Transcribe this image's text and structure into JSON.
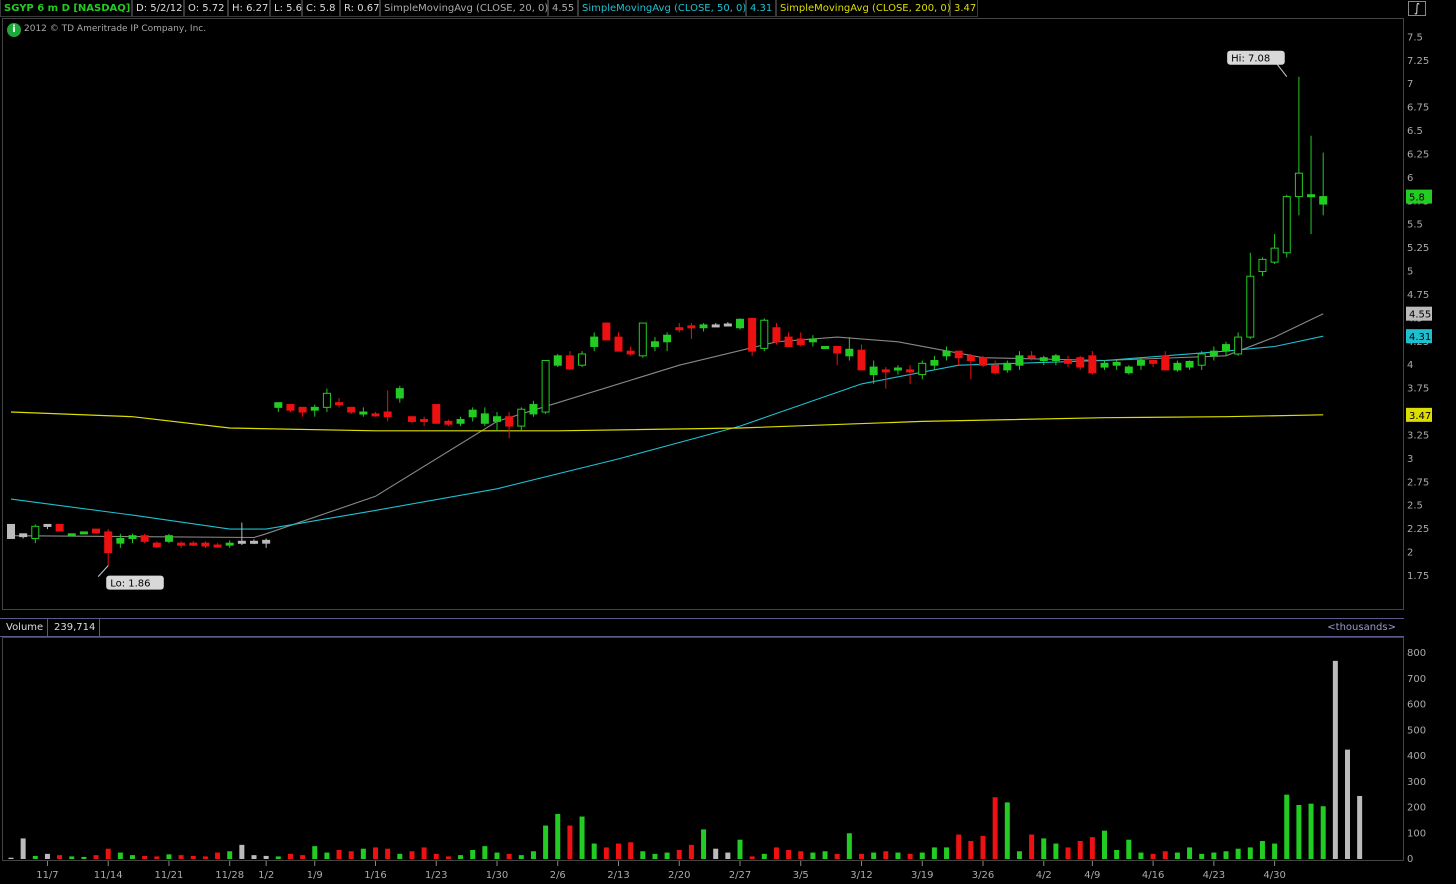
{
  "header": {
    "symbol": "SGYP 6 m D [NASDAQ]",
    "date": "D: 5/2/12",
    "open": "O: 5.72",
    "high": "H: 6.27",
    "low": "L: 5.6",
    "close": "C: 5.8",
    "range": "R: 0.67",
    "sma20_label": "SimpleMovingAvg (CLOSE, 20, 0)",
    "sma20_value": "4.55",
    "sma50_label": "SimpleMovingAvg (CLOSE, 50, 0)",
    "sma50_value": "4.31",
    "sma200_label": "SimpleMovingAvg (CLOSE, 200, 0)",
    "sma200_value": "3.47"
  },
  "copyright": "2012 © TD Ameritrade IP Company, Inc.",
  "icons": {
    "info": "info-icon",
    "tool": "drawing-tool-icon"
  },
  "colors": {
    "up": "#22cc22",
    "down": "#ee1111",
    "neutral": "#bbbbbb",
    "sma20": "#888888",
    "sma50": "#1ec0d0",
    "sma200": "#dddd00",
    "header_symbol": "#22cc22"
  },
  "volume_panel": {
    "label": "Volume",
    "value": "239,714",
    "units": "<thousands>"
  },
  "chart_data": [
    {
      "type": "candlestick",
      "title": "SGYP 6 m D [NASDAQ]",
      "ylim": [
        1.6,
        7.6
      ],
      "y_ticks": [
        "7.5",
        "7.25",
        "7",
        "6.75",
        "6.5",
        "6.25",
        "6",
        "5.75",
        "5.5",
        "5.25",
        "5",
        "4.75",
        "4.5",
        "4.25",
        "4",
        "3.75",
        "3.5",
        "3.25",
        "3",
        "2.75",
        "2.5",
        "2.25",
        "2",
        "1.75"
      ],
      "x_ticks": [
        {
          "label": "11/7",
          "i": 3
        },
        {
          "label": "11/14",
          "i": 8
        },
        {
          "label": "11/21",
          "i": 13
        },
        {
          "label": "11/28",
          "i": 18
        },
        {
          "label": "1/2",
          "i": 21
        },
        {
          "label": "1/9",
          "i": 25
        },
        {
          "label": "1/16",
          "i": 30
        },
        {
          "label": "1/23",
          "i": 35
        },
        {
          "label": "1/30",
          "i": 40
        },
        {
          "label": "2/6",
          "i": 45
        },
        {
          "label": "2/13",
          "i": 50
        },
        {
          "label": "2/20",
          "i": 55
        },
        {
          "label": "2/27",
          "i": 60
        },
        {
          "label": "3/5",
          "i": 65
        },
        {
          "label": "3/12",
          "i": 70
        },
        {
          "label": "3/19",
          "i": 75
        },
        {
          "label": "3/26",
          "i": 80
        },
        {
          "label": "4/2",
          "i": 85
        },
        {
          "label": "4/9",
          "i": 89
        },
        {
          "label": "4/16",
          "i": 94
        },
        {
          "label": "4/23",
          "i": 99
        },
        {
          "label": "4/30",
          "i": 104
        }
      ],
      "ohlc": [
        [
          2.3,
          2.3,
          2.15,
          2.15
        ],
        [
          2.2,
          2.2,
          2.15,
          2.17
        ],
        [
          2.15,
          2.3,
          2.1,
          2.28
        ],
        [
          2.3,
          2.3,
          2.25,
          2.28
        ],
        [
          2.3,
          2.3,
          2.23,
          2.23
        ],
        [
          2.2,
          2.2,
          2.19,
          2.2
        ],
        [
          2.22,
          2.22,
          2.21,
          2.22
        ],
        [
          2.25,
          2.25,
          2.2,
          2.21
        ],
        [
          2.22,
          2.25,
          1.86,
          2.0
        ],
        [
          2.1,
          2.2,
          2.05,
          2.15
        ],
        [
          2.15,
          2.2,
          2.1,
          2.18
        ],
        [
          2.18,
          2.2,
          2.1,
          2.12
        ],
        [
          2.1,
          2.12,
          2.05,
          2.06
        ],
        [
          2.12,
          2.2,
          2.1,
          2.18
        ],
        [
          2.1,
          2.12,
          2.05,
          2.08
        ],
        [
          2.1,
          2.12,
          2.07,
          2.08
        ],
        [
          2.1,
          2.12,
          2.05,
          2.07
        ],
        [
          2.08,
          2.1,
          2.05,
          2.06
        ],
        [
          2.08,
          2.13,
          2.05,
          2.1
        ],
        [
          2.1,
          2.32,
          2.08,
          2.12
        ],
        [
          2.11,
          2.14,
          2.09,
          2.12
        ],
        [
          2.1,
          2.15,
          2.05,
          2.13
        ],
        [
          3.55,
          3.6,
          3.5,
          3.6
        ],
        [
          3.58,
          3.58,
          3.5,
          3.52
        ],
        [
          3.55,
          3.55,
          3.45,
          3.5
        ],
        [
          3.52,
          3.58,
          3.45,
          3.55
        ],
        [
          3.55,
          3.75,
          3.5,
          3.7
        ],
        [
          3.6,
          3.65,
          3.55,
          3.58
        ],
        [
          3.55,
          3.55,
          3.48,
          3.5
        ],
        [
          3.5,
          3.55,
          3.45,
          3.5
        ],
        [
          3.48,
          3.5,
          3.45,
          3.46
        ],
        [
          3.5,
          3.73,
          3.4,
          3.45
        ],
        [
          3.65,
          3.78,
          3.6,
          3.75
        ],
        [
          3.45,
          3.45,
          3.38,
          3.4
        ],
        [
          3.42,
          3.45,
          3.35,
          3.4
        ],
        [
          3.58,
          3.58,
          3.38,
          3.38
        ],
        [
          3.4,
          3.42,
          3.35,
          3.37
        ],
        [
          3.38,
          3.45,
          3.35,
          3.42
        ],
        [
          3.45,
          3.55,
          3.4,
          3.52
        ],
        [
          3.38,
          3.55,
          3.35,
          3.48
        ],
        [
          3.4,
          3.5,
          3.3,
          3.45
        ],
        [
          3.45,
          3.5,
          3.22,
          3.35
        ],
        [
          3.35,
          3.55,
          3.3,
          3.53
        ],
        [
          3.48,
          3.62,
          3.45,
          3.58
        ],
        [
          3.5,
          4.05,
          3.48,
          4.05
        ],
        [
          4.0,
          4.12,
          3.98,
          4.1
        ],
        [
          4.1,
          4.15,
          3.95,
          3.96
        ],
        [
          4.0,
          4.15,
          3.98,
          4.12
        ],
        [
          4.2,
          4.35,
          4.15,
          4.3
        ],
        [
          4.45,
          4.45,
          4.3,
          4.27
        ],
        [
          4.3,
          4.35,
          4.15,
          4.15
        ],
        [
          4.15,
          4.2,
          4.1,
          4.12
        ],
        [
          4.1,
          4.45,
          4.08,
          4.45
        ],
        [
          4.2,
          4.3,
          4.15,
          4.25
        ],
        [
          4.25,
          4.35,
          4.15,
          4.32
        ],
        [
          4.4,
          4.45,
          4.35,
          4.38
        ],
        [
          4.42,
          4.45,
          4.28,
          4.41
        ],
        [
          4.4,
          4.45,
          4.36,
          4.43
        ],
        [
          4.43,
          4.45,
          4.41,
          4.43
        ],
        [
          4.44,
          4.46,
          4.42,
          4.43
        ],
        [
          4.4,
          4.5,
          4.38,
          4.49
        ],
        [
          4.5,
          4.5,
          4.1,
          4.15
        ],
        [
          4.18,
          4.5,
          4.15,
          4.48
        ],
        [
          4.4,
          4.45,
          4.22,
          4.25
        ],
        [
          4.3,
          4.35,
          4.2,
          4.2
        ],
        [
          4.28,
          4.35,
          4.2,
          4.22
        ],
        [
          4.25,
          4.32,
          4.2,
          4.28
        ],
        [
          4.2,
          4.2,
          4.18,
          4.2
        ],
        [
          4.2,
          4.2,
          4.0,
          4.13
        ],
        [
          4.1,
          4.3,
          4.05,
          4.17
        ],
        [
          4.16,
          4.22,
          3.95,
          3.95
        ],
        [
          3.9,
          4.05,
          3.8,
          3.98
        ],
        [
          3.95,
          3.98,
          3.75,
          3.93
        ],
        [
          3.95,
          4.0,
          3.9,
          3.97
        ],
        [
          3.95,
          4.0,
          3.8,
          3.94
        ],
        [
          3.9,
          4.05,
          3.85,
          4.02
        ],
        [
          4.0,
          4.1,
          3.95,
          4.05
        ],
        [
          4.1,
          4.2,
          4.05,
          4.15
        ],
        [
          4.15,
          4.15,
          4.0,
          4.08
        ],
        [
          4.1,
          4.12,
          3.85,
          4.05
        ],
        [
          4.08,
          4.1,
          3.98,
          4.0
        ],
        [
          4.0,
          4.05,
          3.9,
          3.92
        ],
        [
          3.95,
          4.05,
          3.92,
          4.02
        ],
        [
          4.0,
          4.15,
          3.95,
          4.1
        ],
        [
          4.1,
          4.15,
          4.05,
          4.08
        ],
        [
          4.05,
          4.1,
          4.0,
          4.08
        ],
        [
          4.05,
          4.12,
          4.0,
          4.1
        ],
        [
          4.05,
          4.1,
          3.98,
          4.02
        ],
        [
          4.08,
          4.1,
          3.95,
          3.98
        ],
        [
          4.1,
          4.15,
          3.9,
          3.92
        ],
        [
          3.98,
          4.05,
          3.95,
          4.02
        ],
        [
          4.0,
          4.05,
          3.95,
          4.03
        ],
        [
          3.92,
          4.0,
          3.9,
          3.98
        ],
        [
          4.0,
          4.08,
          3.95,
          4.05
        ],
        [
          4.05,
          4.05,
          3.98,
          4.02
        ],
        [
          4.1,
          4.15,
          3.98,
          3.95
        ],
        [
          3.95,
          4.05,
          3.93,
          4.02
        ],
        [
          3.98,
          4.05,
          3.95,
          4.04
        ],
        [
          4.0,
          4.15,
          3.95,
          4.12
        ],
        [
          4.1,
          4.2,
          4.05,
          4.15
        ],
        [
          4.15,
          4.25,
          4.1,
          4.22
        ],
        [
          4.12,
          4.35,
          4.1,
          4.3
        ],
        [
          4.3,
          5.2,
          4.28,
          4.95
        ],
        [
          5.0,
          5.15,
          4.95,
          5.13
        ],
        [
          5.1,
          5.4,
          5.08,
          5.25
        ],
        [
          5.2,
          5.82,
          5.15,
          5.8
        ],
        [
          5.8,
          7.08,
          5.6,
          6.05
        ],
        [
          5.8,
          6.45,
          5.4,
          5.82
        ],
        [
          5.72,
          6.27,
          5.6,
          5.8
        ]
      ],
      "neutral_indices": [
        0,
        1,
        3,
        19,
        20,
        21,
        58,
        59
      ],
      "series": [
        {
          "name": "SimpleMovingAvg (CLOSE, 20, 0)",
          "key": "sma20",
          "values": [
            [
              0,
              2.18
            ],
            [
              20,
              2.16
            ],
            [
              21,
              2.2
            ],
            [
              30,
              2.6
            ],
            [
              40,
              3.4
            ],
            [
              45,
              3.6
            ],
            [
              55,
              4.0
            ],
            [
              63,
              4.25
            ],
            [
              68,
              4.3
            ],
            [
              73,
              4.25
            ],
            [
              80,
              4.08
            ],
            [
              90,
              4.05
            ],
            [
              100,
              4.1
            ],
            [
              104,
              4.3
            ],
            [
              108,
              4.55
            ]
          ]
        },
        {
          "name": "SimpleMovingAvg (CLOSE, 50, 0)",
          "key": "sma50",
          "values": [
            [
              0,
              2.57
            ],
            [
              10,
              2.4
            ],
            [
              18,
              2.25
            ],
            [
              21,
              2.25
            ],
            [
              30,
              2.45
            ],
            [
              40,
              2.68
            ],
            [
              50,
              3.0
            ],
            [
              60,
              3.35
            ],
            [
              70,
              3.8
            ],
            [
              78,
              4.0
            ],
            [
              90,
              4.05
            ],
            [
              100,
              4.15
            ],
            [
              104,
              4.2
            ],
            [
              108,
              4.31
            ]
          ]
        },
        {
          "name": "SimpleMovingAvg (CLOSE, 200, 0)",
          "key": "sma200",
          "values": [
            [
              0,
              3.5
            ],
            [
              10,
              3.45
            ],
            [
              18,
              3.33
            ],
            [
              30,
              3.3
            ],
            [
              45,
              3.3
            ],
            [
              60,
              3.33
            ],
            [
              75,
              3.4
            ],
            [
              90,
              3.44
            ],
            [
              100,
              3.45
            ],
            [
              108,
              3.47
            ]
          ]
        }
      ],
      "annotations": [
        {
          "label": "Hi: 7.08",
          "i": 105,
          "value": 7.08
        },
        {
          "label": "Lo: 1.86",
          "i": 8,
          "value": 1.86
        }
      ],
      "price_tags": [
        {
          "label": "5.8",
          "value": 5.8,
          "key": "up"
        },
        {
          "label": "4.55",
          "value": 4.55,
          "key": "neutral"
        },
        {
          "label": "4.31",
          "value": 4.31,
          "key": "sma50"
        },
        {
          "label": "3.47",
          "value": 3.47,
          "key": "sma200"
        }
      ]
    },
    {
      "type": "bar",
      "title": "Volume",
      "ylim": [
        0,
        820
      ],
      "y_ticks": [
        "800",
        "700",
        "600",
        "500",
        "400",
        "300",
        "200",
        "100",
        "0"
      ],
      "values": [
        5,
        80,
        12,
        20,
        15,
        10,
        8,
        15,
        40,
        25,
        15,
        12,
        10,
        18,
        15,
        12,
        10,
        25,
        30,
        55,
        15,
        12,
        10,
        20,
        15,
        50,
        25,
        35,
        30,
        40,
        45,
        40,
        20,
        30,
        45,
        20,
        10,
        15,
        35,
        50,
        25,
        20,
        15,
        30,
        130,
        175,
        130,
        165,
        60,
        45,
        60,
        65,
        30,
        20,
        25,
        35,
        55,
        115,
        40,
        25,
        75,
        10,
        20,
        45,
        35,
        30,
        25,
        30,
        20,
        100,
        20,
        25,
        30,
        25,
        20,
        25,
        45,
        45,
        95,
        70,
        90,
        240,
        220,
        30,
        95,
        80,
        60,
        45,
        70,
        85,
        110,
        35,
        75,
        25,
        20,
        30,
        25,
        45,
        20,
        25,
        30,
        40,
        45,
        70,
        60,
        250,
        210,
        215,
        205,
        770,
        425,
        245
      ]
    }
  ]
}
